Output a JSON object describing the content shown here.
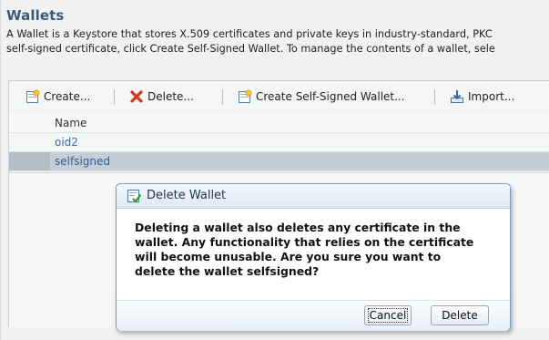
{
  "page": {
    "title": "Wallets",
    "description_lines": [
      "A Wallet is a Keystore that stores X.509 certificates and private keys in industry-standard, PKC",
      "self-signed certificate, click Create Self-Signed Wallet. To manage the contents of a wallet, sele"
    ]
  },
  "toolbar": {
    "create_label": "Create...",
    "delete_label": "Delete...",
    "create_self_signed_label": "Create Self-Signed Wallet...",
    "import_label": "Import..."
  },
  "table": {
    "columns": [
      "Name"
    ],
    "rows": [
      {
        "name": "oid2",
        "selected": false
      },
      {
        "name": "selfsigned",
        "selected": true
      }
    ]
  },
  "dialog": {
    "title": "Delete Wallet",
    "message_lines": [
      "Deleting a wallet also deletes any certificate in the",
      "wallet. Any functionality that relies on the certificate",
      "will become unusable. Are you sure you want to",
      "delete the wallet selfsigned?"
    ],
    "cancel_label": "Cancel",
    "delete_label": "Delete"
  },
  "colors": {
    "heading": "#3a5a7c",
    "link": "#3a6aa5",
    "selected_row": "#c5cdd5",
    "dialog_border": "#7a9cc2"
  },
  "icons": {
    "create": "create-wallet-icon",
    "delete": "red-x-icon",
    "self_signed": "self-signed-wallet-icon",
    "import": "import-icon",
    "dialog": "confirm-checkmark-icon"
  }
}
